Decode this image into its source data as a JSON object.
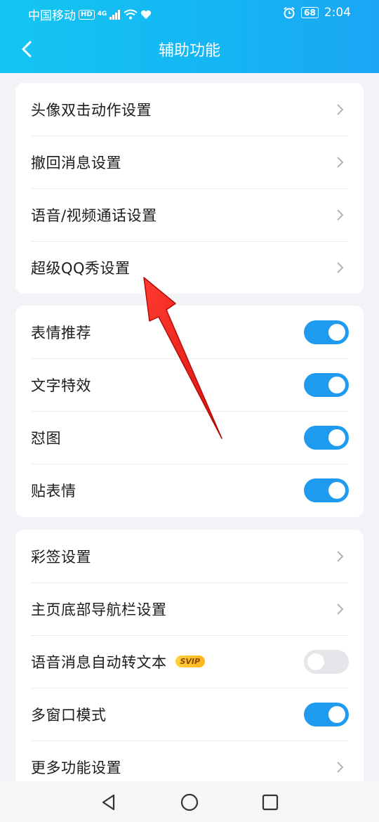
{
  "statusbar": {
    "carrier": "中国移动",
    "hd": "HD",
    "net": "4G",
    "battery": "68",
    "time": "2:04"
  },
  "header": {
    "title": "辅助功能"
  },
  "sections": [
    {
      "rows": [
        {
          "label": "头像双击动作设置",
          "control": "chevron"
        },
        {
          "label": "撤回消息设置",
          "control": "chevron"
        },
        {
          "label": "语音/视频通话设置",
          "control": "chevron"
        },
        {
          "label": "超级QQ秀设置",
          "control": "chevron"
        }
      ]
    },
    {
      "rows": [
        {
          "label": "表情推荐",
          "control": "toggle",
          "on": true
        },
        {
          "label": "文字特效",
          "control": "toggle",
          "on": true
        },
        {
          "label": "怼图",
          "control": "toggle",
          "on": true
        },
        {
          "label": "贴表情",
          "control": "toggle",
          "on": true
        }
      ]
    },
    {
      "rows": [
        {
          "label": "彩签设置",
          "control": "chevron"
        },
        {
          "label": "主页底部导航栏设置",
          "control": "chevron"
        },
        {
          "label": "语音消息自动转文本",
          "badge": "SVIP",
          "control": "toggle",
          "on": false
        },
        {
          "label": "多窗口模式",
          "control": "toggle",
          "on": true
        },
        {
          "label": "更多功能设置",
          "control": "chevron"
        }
      ]
    }
  ],
  "colors": {
    "header": "#14b6f3",
    "toggle_on": "#1e9bef",
    "toggle_off": "#e5e5ea",
    "annotation_arrow": "#e8201c"
  },
  "icons": {
    "back": "chevron-left-icon",
    "row_arrow": "chevron-right-icon",
    "nav": [
      "back-triangle-icon",
      "home-circle-icon",
      "recents-square-icon"
    ]
  }
}
